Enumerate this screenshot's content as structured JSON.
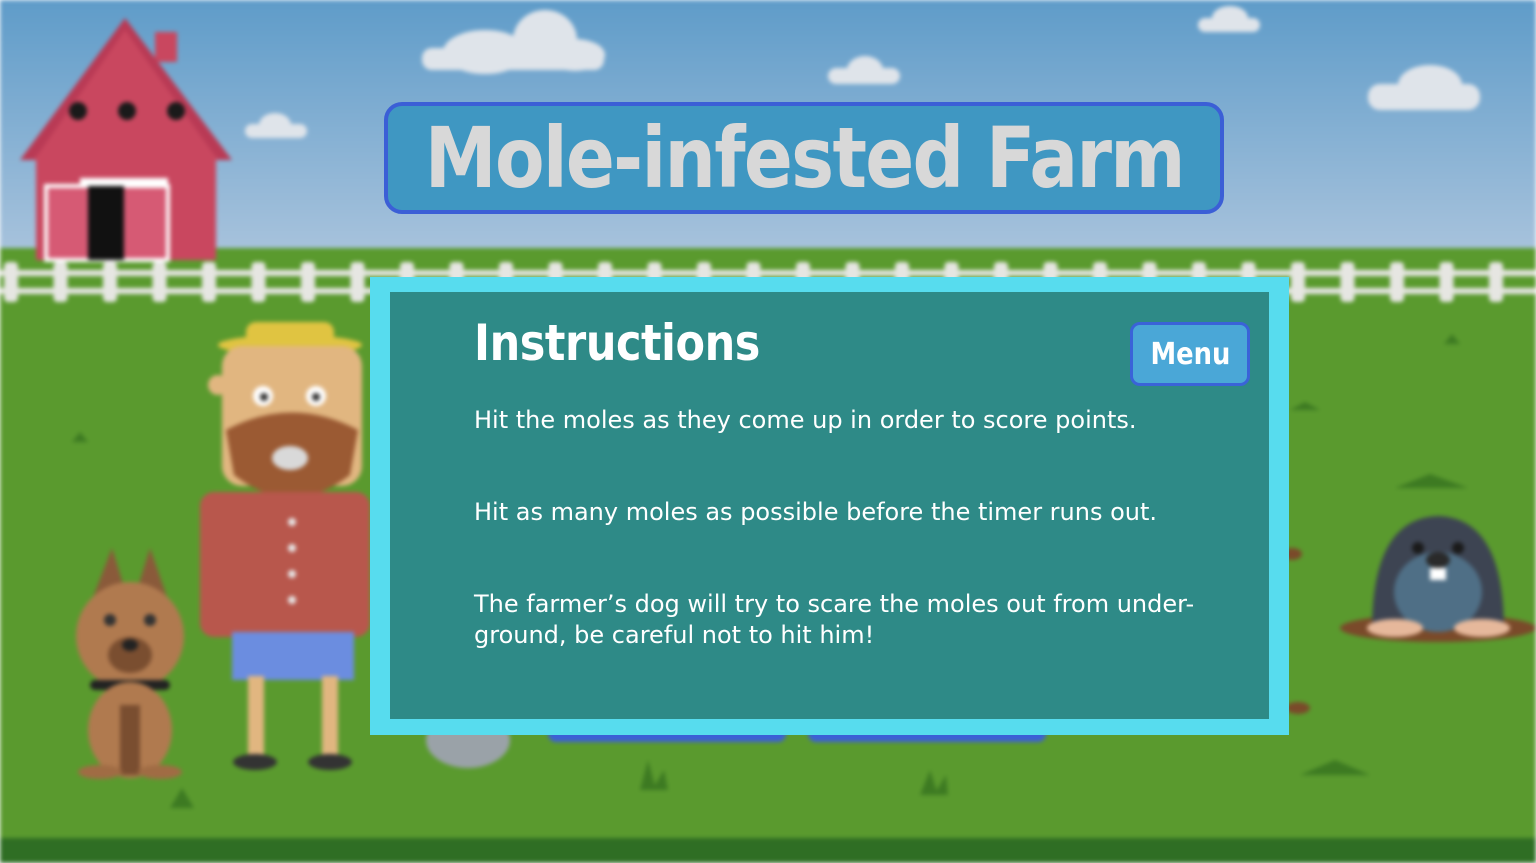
{
  "title": "Mole-infested Farm",
  "instructions": {
    "heading": "Instructions",
    "menu_label": "Menu",
    "lines": [
      "Hit the moles as they come up in order to score points.",
      "Hit as many moles as possible before the timer runs out.",
      "The farmer’s dog will try to scare the moles out from under-ground, be careful not to hit him!"
    ]
  },
  "colors": {
    "sky_top": "#5f9cc9",
    "sky_bottom": "#aac4dd",
    "grass": "#5a9a2e",
    "panel_border": "#57dcee",
    "panel_fill": "#2e8a87",
    "title_banner": "#3f97c2",
    "barn": "#c9475f"
  }
}
